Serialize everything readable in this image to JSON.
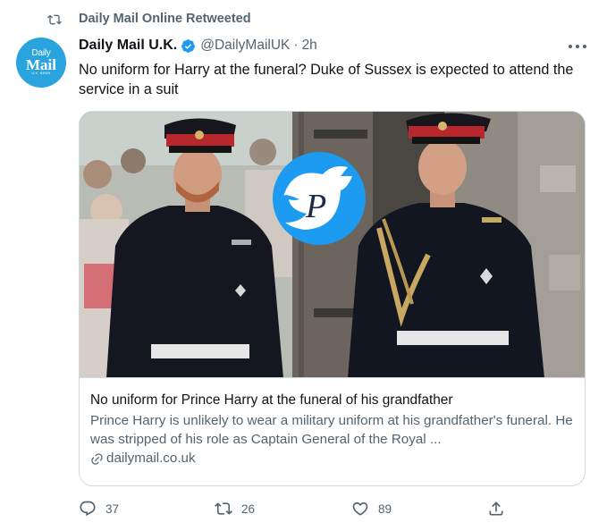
{
  "retweet_banner": {
    "label": "Daily Mail Online Retweeted",
    "icon": "retweet-icon"
  },
  "avatar": {
    "line1": "Daily",
    "line2": "Mail",
    "line3": "U.K. NEWS",
    "bg": "#2aa4de"
  },
  "tweet": {
    "display_name": "Daily Mail U.K.",
    "verified": true,
    "handle": "@DailyMailUK",
    "separator": "·",
    "time": "2h",
    "text": "No uniform for Harry at the funeral? Duke of Sussex is expected to attend the service in a suit"
  },
  "card": {
    "image_watermark": "P",
    "title": "No uniform for Prince Harry at the funeral of his grandfather",
    "description": "Prince Harry is unlikely to wear a military uniform at his grandfather's funeral. He was stripped of his role as Captain General of the Royal ...",
    "domain": "dailymail.co.uk"
  },
  "actions": {
    "reply": {
      "icon": "reply-icon",
      "count": "37"
    },
    "retweet": {
      "icon": "retweet-icon",
      "count": "26"
    },
    "like": {
      "icon": "heart-icon",
      "count": "89"
    },
    "share": {
      "icon": "share-icon"
    }
  },
  "colors": {
    "secondary_text": "#536471",
    "verified_blue": "#1d9bf0",
    "border": "#cfd9de"
  }
}
